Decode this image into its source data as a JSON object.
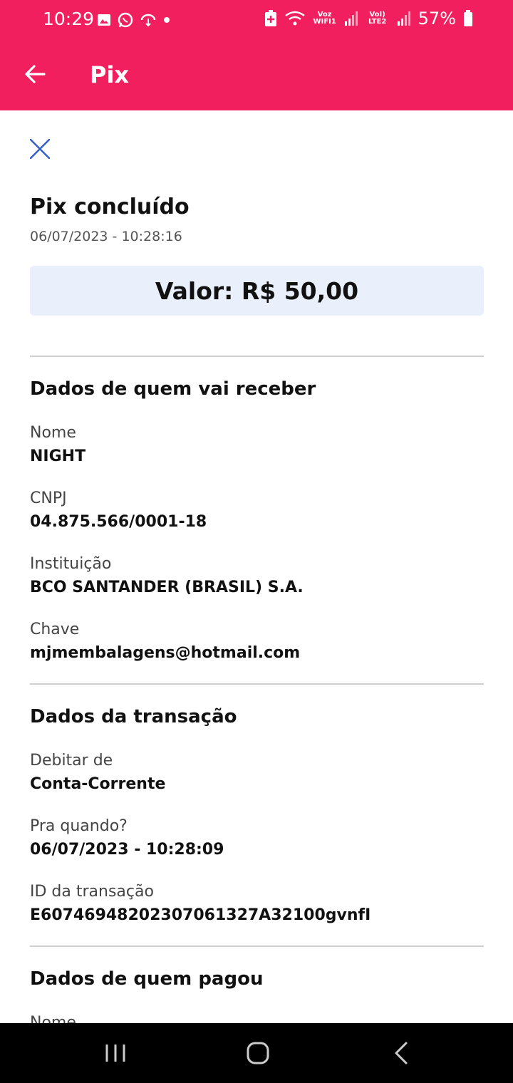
{
  "status_bar": {
    "time": "10:29",
    "battery": "57%",
    "wifi_label": "Voz WIFI1",
    "lte_label": "VoI) LTE2"
  },
  "app_bar": {
    "title": "Pix"
  },
  "header": {
    "title": "Pix concluído",
    "datetime": "06/07/2023 - 10:28:16",
    "amount": "Valor: R$ 50,00"
  },
  "receiver": {
    "section_title": "Dados de quem vai receber",
    "fields": [
      {
        "label": "Nome",
        "value": "NIGHT"
      },
      {
        "label": "CNPJ",
        "value": "04.875.566/0001-18"
      },
      {
        "label": "Instituição",
        "value": "BCO SANTANDER (BRASIL) S.A."
      },
      {
        "label": "Chave",
        "value": "mjmembalagens@hotmail.com"
      }
    ]
  },
  "transaction": {
    "section_title": "Dados da transação",
    "fields": [
      {
        "label": "Debitar de",
        "value": "Conta-Corrente"
      },
      {
        "label": "Pra quando?",
        "value": "06/07/2023 - 10:28:09"
      },
      {
        "label": "ID da transação",
        "value": "E60746948202307061327A32100gvnfI"
      }
    ]
  },
  "payer": {
    "section_title": "Dados de quem pagou",
    "fields": [
      {
        "label": "Nome"
      }
    ]
  },
  "colors": {
    "brand": "#F21F5E",
    "amount_bg": "#E9EFFB",
    "close_icon": "#2F5CC8"
  }
}
